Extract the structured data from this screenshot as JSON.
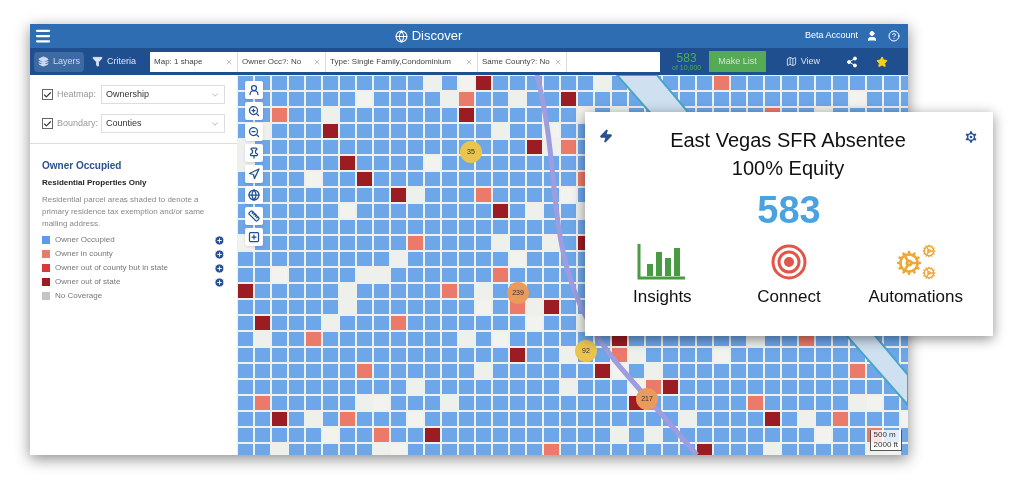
{
  "header": {
    "title": "Discover",
    "account": "Beta Account"
  },
  "toolbar": {
    "tabs": [
      {
        "label": "Layers",
        "selected": true
      },
      {
        "label": "Criteria",
        "selected": false
      }
    ],
    "filters": [
      "Map: 1 shape",
      "Owner Occ?: No",
      "Type: Single Family,Condominium",
      "Same County?: No"
    ],
    "count": "583",
    "count_total": "of 10,000",
    "make_list": "Make List",
    "view": "View"
  },
  "sidebar": {
    "layers": [
      {
        "label": "Heatmap:",
        "value": "Ownership",
        "checked": true
      },
      {
        "label": "Boundary:",
        "value": "Counties",
        "checked": true
      }
    ],
    "legend": {
      "title": "Owner Occupied",
      "subtitle": "Residential Properties Only",
      "description": "Residential parcel areas shaded to denote a primary residence tax exemption and/or same mailing address.",
      "items": [
        {
          "label": "Owner Occupied",
          "color": "#5b9bea",
          "add": true
        },
        {
          "label": "Owner in county",
          "color": "#ec7a6a",
          "add": true
        },
        {
          "label": "Owner out of county but in state",
          "color": "#d63a3a",
          "add": true
        },
        {
          "label": "Owner out of state",
          "color": "#9c1c24",
          "add": true
        },
        {
          "label": "No Coverage",
          "color": "#c4c4c4",
          "add": false
        }
      ]
    }
  },
  "map": {
    "clusters": [
      {
        "label": "35",
        "color": "#e9c54e"
      },
      {
        "label": "239",
        "color": "#ea9a5a"
      },
      {
        "label": "92",
        "color": "#e9c54e"
      },
      {
        "label": "217",
        "color": "#ea9a5a"
      }
    ],
    "scale": [
      "500 m",
      "2000 ft"
    ]
  },
  "card": {
    "title": "East Vegas SFR Absentee",
    "subtitle": "100% Equity",
    "count": "583",
    "actions": [
      {
        "kind": "insights",
        "label": "Insights"
      },
      {
        "kind": "connect",
        "label": "Connect"
      },
      {
        "kind": "automations",
        "label": "Automations"
      }
    ]
  }
}
